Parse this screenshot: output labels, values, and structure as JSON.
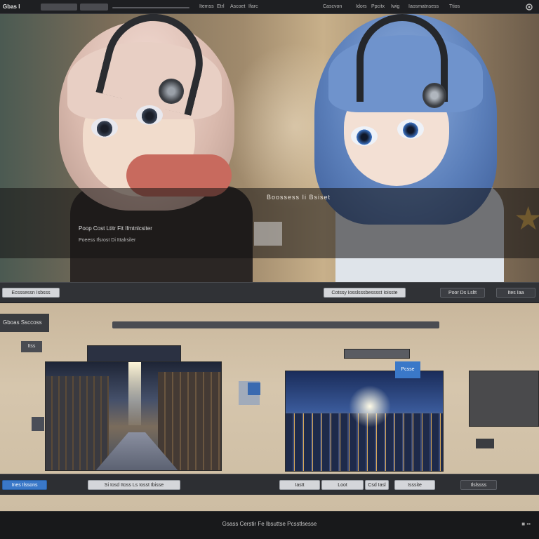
{
  "topbar": {
    "brand": "Gbas I",
    "links": [
      "Itemss",
      "Etrl",
      "Ascoet",
      "Ifarc"
    ],
    "right_links": [
      "Cascvon",
      "Idors",
      "Ppcitx",
      "Iwig",
      "Iaosmatnsess",
      "Ttios"
    ],
    "settings_icon": "gear-icon"
  },
  "hero": {
    "title": "Boossess Ii Bsiset",
    "line1": "Poop Cost Ltitr Fit Ifmtnlcsiter",
    "line2": "Poeess Ifsrost  Di Ittalrsiler"
  },
  "bar1": {
    "left_button": "Ecsssessn Isbsss",
    "center_button": "Cotssy Iosslsssbesssst Ioisste",
    "right_button": "Poor Ds Lsltt",
    "far_right_button": "Ites Iaa"
  },
  "gallery": {
    "tag": "Gboas Ssccoss",
    "small_tag": "Itss",
    "pic_tag": "Pcsse"
  },
  "bar2": {
    "blue_button": "Ines Ilssons",
    "center_button": "Si Iosd Itoss Ls Iosst Ibisse",
    "btn3": "Iastt",
    "btn4": "Loot",
    "btn5": "Csd Iasl",
    "btn6": "Isssite",
    "btn7": "Ilslssss"
  },
  "footer": {
    "text": "Gsass Cerstir Fe Ibsuttse Pcsstlsesse",
    "icons": "■ ▪▪"
  },
  "colors": {
    "accent": "#3a78c8",
    "bar": "#303236",
    "footer": "#18191b"
  }
}
